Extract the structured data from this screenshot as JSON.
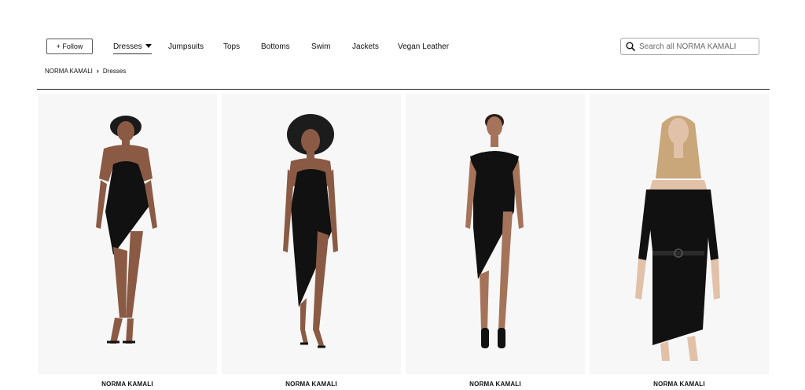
{
  "header": {
    "follow_label": "+ Follow",
    "nav": [
      {
        "label": "Dresses",
        "active": true
      },
      {
        "label": "Jumpsuits"
      },
      {
        "label": "Tops"
      },
      {
        "label": "Bottoms"
      },
      {
        "label": "Swim"
      },
      {
        "label": "Jackets"
      },
      {
        "label": "Vegan Leather"
      }
    ],
    "search_placeholder": "Search all NORMA KAMALI"
  },
  "breadcrumb": {
    "root": "NORMA KAMALI",
    "current": "Dresses"
  },
  "products": [
    {
      "brand": "NORMA KAMALI"
    },
    {
      "brand": "NORMA KAMALI"
    },
    {
      "brand": "NORMA KAMALI"
    },
    {
      "brand": "NORMA KAMALI"
    }
  ],
  "colors": {
    "image_bg": "#f7f7f7",
    "dress": "#111111",
    "skin_dark": "#8a5a44",
    "skin_light": "#d9b49c",
    "hair_blonde": "#c9a77a"
  }
}
